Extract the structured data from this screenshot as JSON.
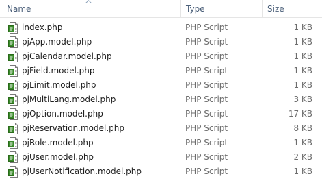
{
  "columns": {
    "name": "Name",
    "type": "Type",
    "size": "Size"
  },
  "sort": {
    "column": "Name",
    "direction": "ascending",
    "icon": "sort-up-arrow"
  },
  "file_icon": "php-script-file-icon",
  "files": [
    {
      "name": "index.php",
      "type": "PHP Script",
      "size": "1 KB"
    },
    {
      "name": "pjApp.model.php",
      "type": "PHP Script",
      "size": "1 KB"
    },
    {
      "name": "pjCalendar.model.php",
      "type": "PHP Script",
      "size": "1 KB"
    },
    {
      "name": "pjField.model.php",
      "type": "PHP Script",
      "size": "1 KB"
    },
    {
      "name": "pjLimit.model.php",
      "type": "PHP Script",
      "size": "1 KB"
    },
    {
      "name": "pjMultiLang.model.php",
      "type": "PHP Script",
      "size": "3 KB"
    },
    {
      "name": "pjOption.model.php",
      "type": "PHP Script",
      "size": "17 KB"
    },
    {
      "name": "pjReservation.model.php",
      "type": "PHP Script",
      "size": "8 KB"
    },
    {
      "name": "pjRole.model.php",
      "type": "PHP Script",
      "size": "1 KB"
    },
    {
      "name": "pjUser.model.php",
      "type": "PHP Script",
      "size": "2 KB"
    },
    {
      "name": "pjUserNotification.model.php",
      "type": "PHP Script",
      "size": "1 KB"
    }
  ],
  "colors": {
    "header_text": "#4c607a",
    "name_text": "#1e1e1e",
    "secondary_text": "#6d6d6d",
    "icon_green": "#3a8a2a"
  }
}
